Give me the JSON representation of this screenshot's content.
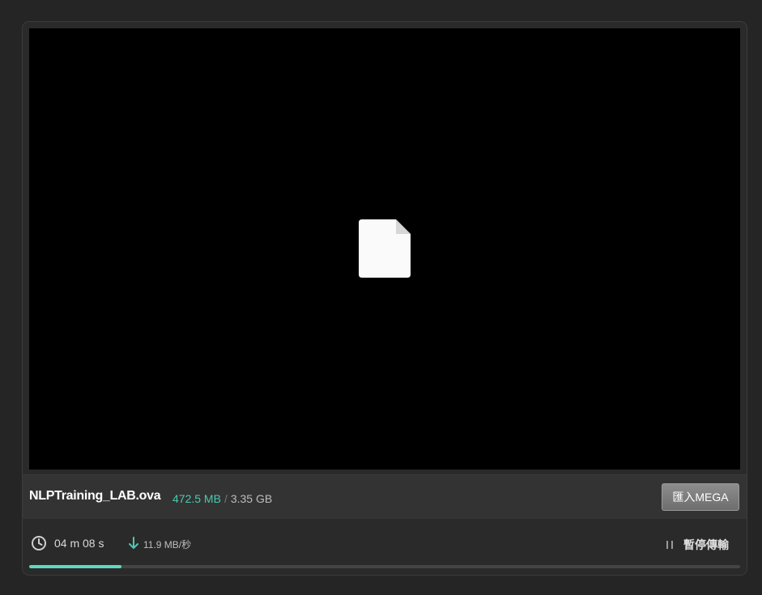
{
  "file": {
    "name": "NLPTraining_LAB.ova",
    "downloaded": "472.5 MB",
    "separator": "/",
    "total": "3.35 GB",
    "icon": "document-icon"
  },
  "actions": {
    "import_label": "匯入MEGA",
    "pause_label": "暫停傳輸"
  },
  "status": {
    "time_remaining": "04 m  08 s",
    "speed": "11.9 MB/秒",
    "progress_fraction": 0.13
  },
  "colors": {
    "accent": "#5fd9bd",
    "downloaded_text": "#4cc9b0",
    "background": "#252525"
  }
}
